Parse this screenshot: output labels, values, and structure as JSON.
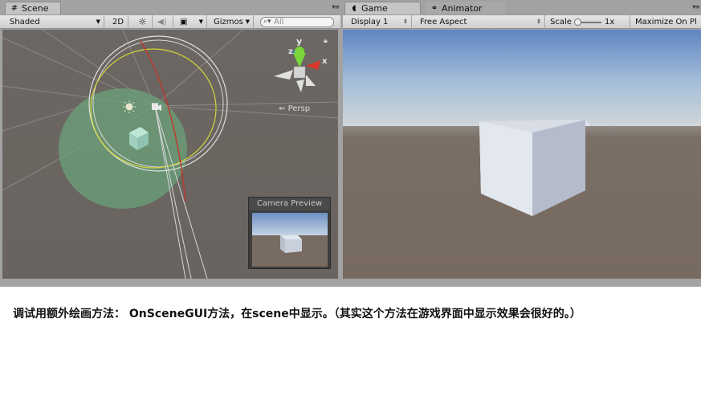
{
  "scene_panel": {
    "tab_label": "Scene",
    "toolbar": {
      "shading_mode": "Shaded",
      "toggle_2d": "2D",
      "gizmos_label": "Gizmos",
      "search_placeholder": "All"
    },
    "axis_labels": {
      "y": "y",
      "z": "z",
      "x": "x"
    },
    "projection_label": "Persp",
    "camera_preview_title": "Camera Preview"
  },
  "game_panel": {
    "tabs": [
      {
        "label": "Game"
      },
      {
        "label": "Animator"
      }
    ],
    "toolbar": {
      "display": "Display 1",
      "aspect": "Free Aspect",
      "scale_label": "Scale",
      "scale_value": "1x",
      "maximize_label": "Maximize On Pl"
    }
  },
  "caption": "调试用额外绘画方法： OnSceneGUI方法，在scene中显示。（其实这个方法在游戏界面中显示效果会很好的。）"
}
